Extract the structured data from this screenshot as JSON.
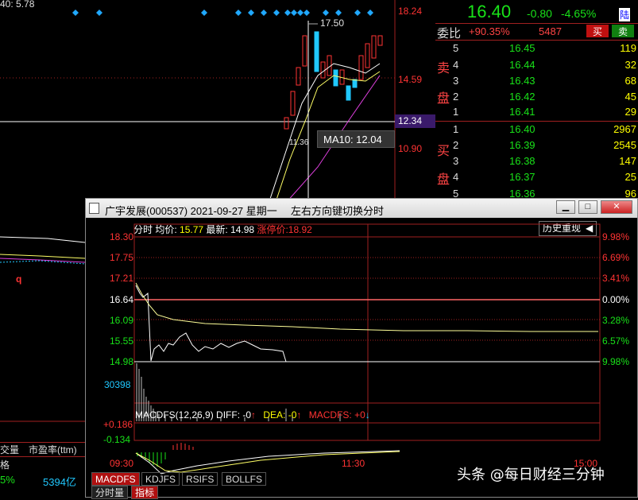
{
  "bg": {
    "top_left_label": "40: 5.78",
    "max_price_label": "17.50",
    "ma_tooltip": "MA10: 12.04",
    "low_label": "11.36",
    "axis": [
      "18.24",
      "14.59",
      "12.34",
      "10.90"
    ],
    "left_q": "q",
    "left_table": {
      "h1": "交量",
      "h2": "市盈率(ttm)",
      "h3": "格",
      "v1": "5%",
      "v2": "5394亿"
    }
  },
  "quote": {
    "price": "16.40",
    "change": "-0.80",
    "pct": "-4.65%",
    "badge": "陆"
  },
  "weibi": {
    "label": "委比",
    "value": "+90.35%",
    "diff": "5487",
    "sell_btn": "买",
    "buy_btn": "卖"
  },
  "orderbook": {
    "sell_label_1": "卖",
    "sell_label_2": "盘",
    "buy_label_1": "买",
    "buy_label_2": "盘",
    "sell": [
      {
        "idx": "5",
        "price": "16.45",
        "vol": "119"
      },
      {
        "idx": "4",
        "price": "16.44",
        "vol": "32"
      },
      {
        "idx": "3",
        "price": "16.43",
        "vol": "68"
      },
      {
        "idx": "2",
        "price": "16.42",
        "vol": "45"
      },
      {
        "idx": "1",
        "price": "16.41",
        "vol": "29"
      }
    ],
    "buy": [
      {
        "idx": "1",
        "price": "16.40",
        "vol": "2967"
      },
      {
        "idx": "2",
        "price": "16.39",
        "vol": "2545"
      },
      {
        "idx": "3",
        "price": "16.38",
        "vol": "147"
      },
      {
        "idx": "4",
        "price": "16.37",
        "vol": "25"
      },
      {
        "idx": "5",
        "price": "16.36",
        "vol": "96"
      }
    ]
  },
  "popup": {
    "title": "广宇发展(000537) 2021-09-27 星期一",
    "hint": "左右方向键切换分时",
    "info_label": "分时 均价:",
    "avg": "15.77",
    "latest_label": "最新:",
    "latest": "14.98",
    "limit_label": "涨停价:",
    "limit": "18.92",
    "history_btn": "历史重现",
    "left_axis": [
      "18.30",
      "17.75",
      "17.21",
      "16.64",
      "16.09",
      "15.55",
      "14.98"
    ],
    "right_axis": [
      "9.98%",
      "6.69%",
      "3.41%",
      "0.00%",
      "3.28%",
      "6.57%",
      "9.98%"
    ],
    "vol_label": "30398",
    "macd_label": "MACDFS(12,26,9) DIFF: -0",
    "dea_label": "DEA: -0",
    "macdfs_label": "MACDFS: +0",
    "macd_axis": [
      "+0.186",
      "-0.134"
    ],
    "time_axis": [
      "09:30",
      "11:30",
      "15:00"
    ],
    "tabs": [
      "MACDFS",
      "KDJFS",
      "RSIFS",
      "BOLLFS"
    ],
    "bottom_tabs": [
      "分时量",
      "指标"
    ]
  },
  "watermark": "头条 @每日财经三分钟"
}
